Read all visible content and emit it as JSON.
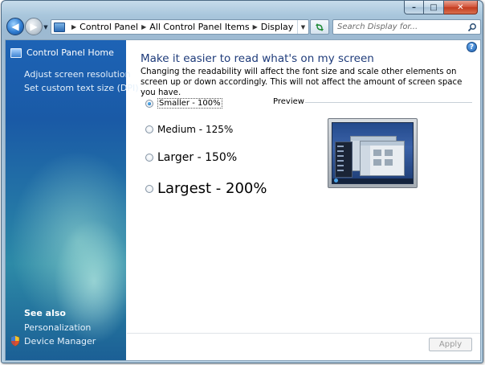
{
  "window": {
    "minimize_glyph": "–",
    "maximize_glyph": "□",
    "close_glyph": "✕"
  },
  "navbar": {
    "back_glyph": "◀",
    "forward_glyph": "▶",
    "breadcrumb": [
      "Control Panel",
      "All Control Panel Items",
      "Display"
    ],
    "search_placeholder": "Search Display for..."
  },
  "sidebar": {
    "home": "Control Panel Home",
    "tasks": [
      "Adjust screen resolution",
      "Set custom text size (DPI)"
    ],
    "see_also_title": "See also",
    "see_also": [
      "Personalization",
      "Device Manager"
    ]
  },
  "content": {
    "help_glyph": "?",
    "heading": "Make it easier to read what's on my screen",
    "description": "Changing the readability will affect the font size and scale other elements on screen up or down accordingly. This will not affect the amount of screen space you have.",
    "options": [
      {
        "label": "Smaller - 100%",
        "checked": true
      },
      {
        "label": "Medium - 125%",
        "checked": false
      },
      {
        "label": "Larger - 150%",
        "checked": false
      },
      {
        "label": "Largest - 200%",
        "checked": false
      }
    ],
    "preview_label": "Preview",
    "apply_label": "Apply",
    "apply_enabled": false
  },
  "icons": {
    "address": "control-panel-icon",
    "search": "search-icon",
    "refresh": "refresh-icon",
    "home": "control-panel-icon",
    "device_manager": "shield-icon",
    "help": "help-icon"
  },
  "colors": {
    "heading": "#1e3b7a",
    "sidebar_top": "#1d63b5",
    "sidebar_bottom": "#1b5f95"
  }
}
